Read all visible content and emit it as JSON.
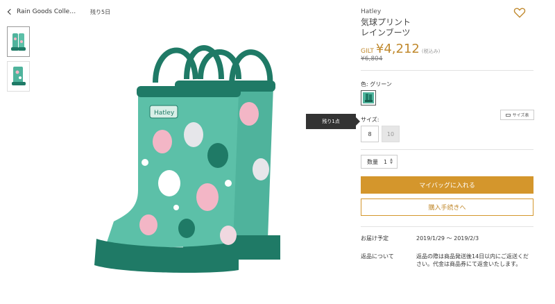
{
  "header": {
    "back_label": "Rain Goods Collec...",
    "stock_label": "残り5日"
  },
  "thumbnails": [
    {
      "label": "thumbnail-1"
    },
    {
      "label": "thumbnail-2"
    }
  ],
  "tooltip": {
    "text": "残り1点"
  },
  "product": {
    "brand": "Hatley",
    "name": "気球プリント\nレインブーツ",
    "price_prefix": "GILT",
    "price": "¥4,212",
    "tax_note": "(税込み)",
    "original_price": "¥6,804"
  },
  "color": {
    "label": "色: グリーン",
    "swatch_hex": "#4fb39c"
  },
  "size": {
    "label": "サイズ:",
    "guide_label": "サイズ表",
    "options": [
      "8",
      "10"
    ]
  },
  "quantity": {
    "label": "数量",
    "value": "1"
  },
  "actions": {
    "add_to_bag": "マイバッグに入れる",
    "checkout": "購入手続きへ"
  },
  "delivery": {
    "label": "お届け予定",
    "value": "2019/1/29 〜 2019/2/3"
  },
  "returns": {
    "label": "返品について",
    "value": "返品の際は商品発送後14日以内にご返送ください。代金は商品券にて返金いたします。"
  },
  "colors": {
    "accent": "#d4962c",
    "price": "#c0892d",
    "boot_teal": "#4fb39c",
    "boot_dark": "#1f7a66"
  }
}
